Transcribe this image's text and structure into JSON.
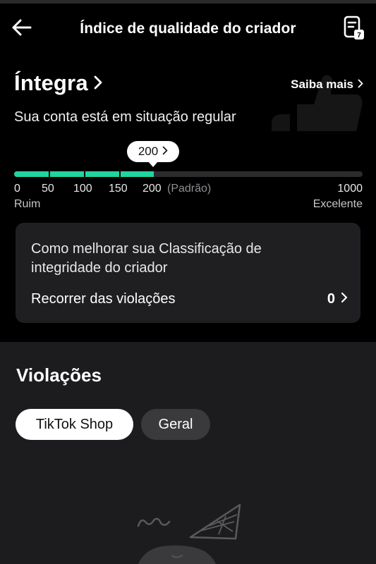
{
  "header": {
    "title": "Índice de qualidade do criador",
    "back_icon": "arrow-left-icon",
    "report_icon": "report-document-icon",
    "report_badge": "7"
  },
  "status": {
    "label": "Íntegra",
    "learn_more": "Saiba mais",
    "subtitle": "Sua conta está em situação regular"
  },
  "score": {
    "current": "200",
    "current_value": 200,
    "max_value": 1000,
    "ticks": [
      "0",
      "50",
      "100",
      "150",
      "200"
    ],
    "standard_note": "(Padrão)",
    "max_label": "1000",
    "low_label": "Ruim",
    "high_label": "Excelente",
    "accent_color": "#20d5a0"
  },
  "improve_card": {
    "text": "Como melhorar sua Classificação de integridade do criador",
    "appeal_label": "Recorrer das violações",
    "appeal_count": "0"
  },
  "violations": {
    "title": "Violações",
    "tabs": [
      {
        "label": "TikTok Shop",
        "active": true
      },
      {
        "label": "Geral",
        "active": false
      }
    ]
  }
}
